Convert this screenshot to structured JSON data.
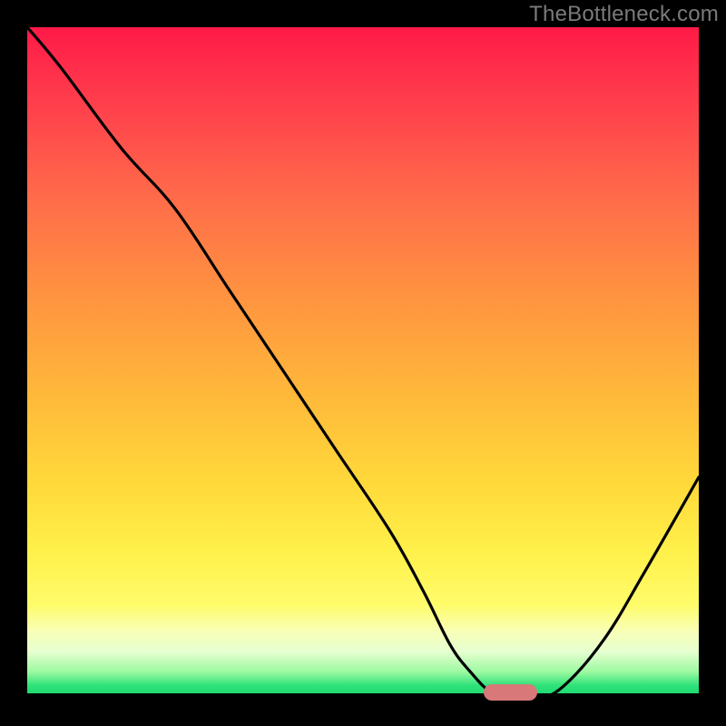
{
  "watermark": "TheBottleneck.com",
  "chart_data": {
    "type": "line",
    "title": "",
    "xlabel": "",
    "ylabel": "",
    "xlim": [
      0,
      100
    ],
    "ylim": [
      0,
      100
    ],
    "grid": false,
    "legend": false,
    "series": [
      {
        "name": "bottleneck-curve",
        "x": [
          0,
          5,
          14,
          22,
          30,
          38,
          46,
          54,
          59,
          63,
          66,
          69,
          72,
          76,
          80,
          86,
          92,
          100
        ],
        "values": [
          100,
          94,
          82,
          73,
          61,
          49,
          37,
          25,
          16,
          8,
          4,
          1,
          0,
          0,
          2,
          9,
          19,
          33
        ]
      }
    ],
    "marker": {
      "x_start": 68,
      "x_end": 76,
      "y": 0,
      "color": "#d87878"
    },
    "background_gradient": {
      "top": "#ff1a47",
      "mid": "#ffd93a",
      "bottom": "#15d46a"
    }
  }
}
